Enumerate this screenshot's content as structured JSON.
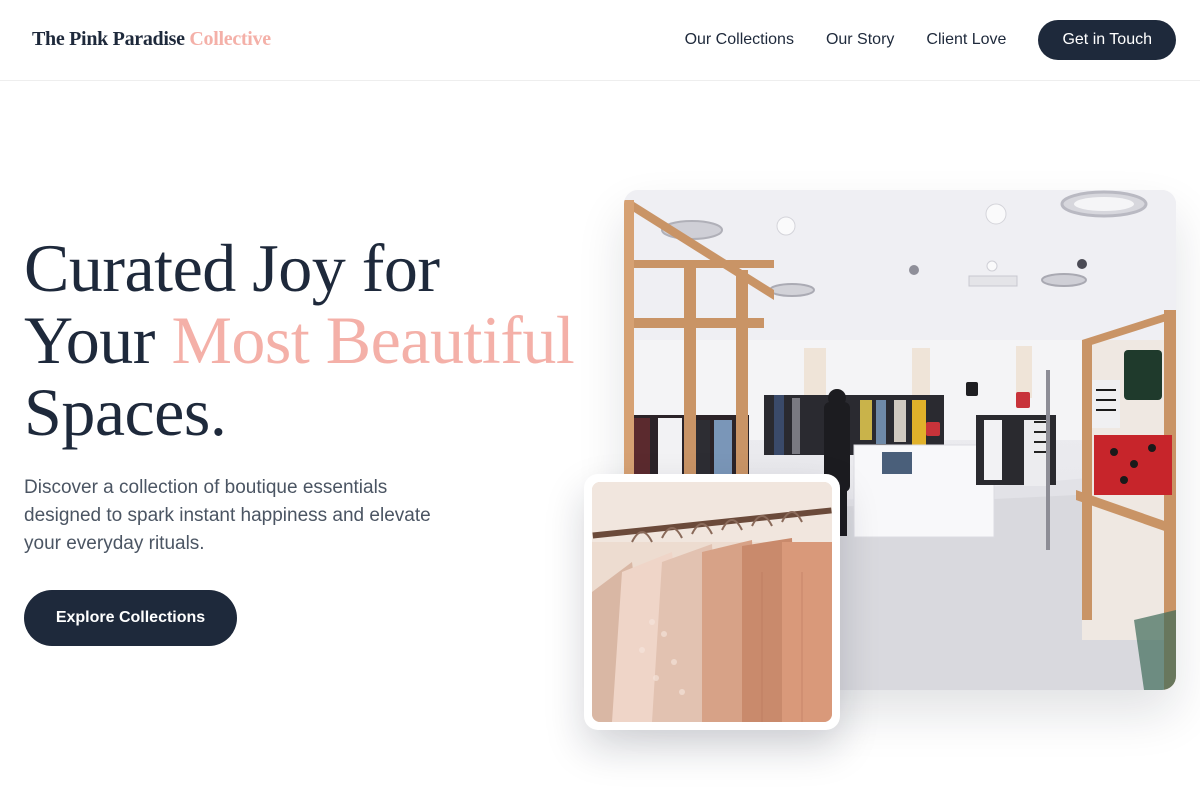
{
  "brand": {
    "name_main": "The Pink Paradise",
    "name_accent": "Collective"
  },
  "nav": {
    "links": [
      "Our Collections",
      "Our Story",
      "Client Love"
    ],
    "cta_label": "Get in Touch"
  },
  "hero": {
    "title_part1": "Curated Joy for Your ",
    "title_highlight": "Most Beautiful",
    "title_part2": " Spaces.",
    "subtitle": "Discover a collection of boutique essentials designed to spark instant happiness and elevate your everyday rituals.",
    "cta_label": "Explore Collections"
  },
  "images": {
    "main": "boutique-store-interior",
    "secondary": "clothing-rack-blush-garments"
  },
  "colors": {
    "primary_dark": "#1e293b",
    "accent_pink": "#f4b0a8",
    "body_text": "#4b5563"
  }
}
